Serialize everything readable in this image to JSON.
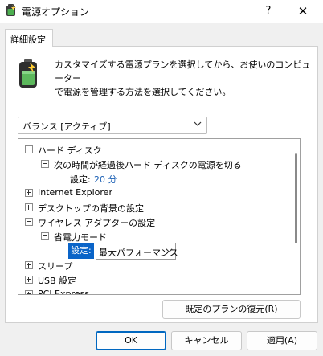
{
  "window": {
    "title": "電源オプション",
    "help_label": "?",
    "close_label": "✕"
  },
  "tab": {
    "label": "詳細設定"
  },
  "description": {
    "line1": "カスタマイズする電源プランを選択してから、お使いのコンピューター",
    "line2": "で電源を管理する方法を選択してください。"
  },
  "plan_select": {
    "value": "バランス [アクティブ]"
  },
  "tree": {
    "hard_disk": "ハード ディスク",
    "hard_disk_child": "次の時間が経過後ハード ディスクの電源を切る",
    "hard_disk_setting_label": "設定:",
    "hard_disk_setting_value": "20 分",
    "internet_explorer": "Internet Explorer",
    "desktop_background": "デスクトップの背景の設定",
    "wireless_adapter": "ワイヤレス アダプターの設定",
    "power_saving_mode": "省電力モード",
    "power_setting_label": "設定:",
    "power_setting_value": "最大パフォーマンス",
    "sleep": "スリープ",
    "usb": "USB 設定",
    "pci_express": "PCI Express"
  },
  "buttons": {
    "restore": "既定のプランの復元(R)",
    "ok": "OK",
    "cancel": "キャンセル",
    "apply": "適用(A)"
  },
  "colors": {
    "accent": "#0067c0",
    "selection": "#0a64c8",
    "link": "#1a5fb4"
  }
}
